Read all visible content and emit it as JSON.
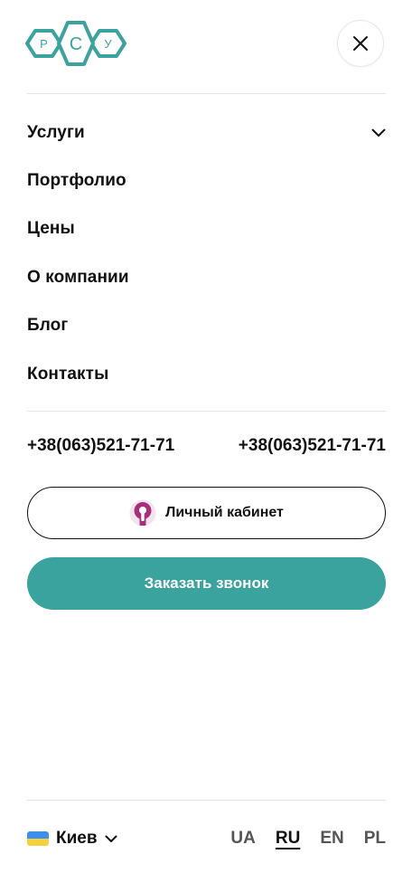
{
  "logo": {
    "letters": [
      "Р",
      "С",
      "У"
    ],
    "color": "#3ba39d"
  },
  "menu": {
    "items": [
      {
        "label": "Услуги",
        "has_dropdown": true
      },
      {
        "label": "Портфолио"
      },
      {
        "label": "Цены"
      },
      {
        "label": "О компании"
      },
      {
        "label": "Блог"
      },
      {
        "label": "Контакты"
      }
    ]
  },
  "phones": [
    "+38(063)521-71-71",
    "+38(063)521-71-71"
  ],
  "cabinet_button": {
    "label": "Личный кабинет",
    "icon": "keyhole-icon",
    "icon_color": "#a6317a"
  },
  "call_button": {
    "label": "Заказать звонок",
    "color": "#3ba39d"
  },
  "footer": {
    "city": "Киев",
    "flag_colors": [
      "#3b8ff0",
      "#f5d13d"
    ],
    "languages": [
      "UA",
      "RU",
      "EN",
      "PL"
    ],
    "active_language": "RU"
  }
}
